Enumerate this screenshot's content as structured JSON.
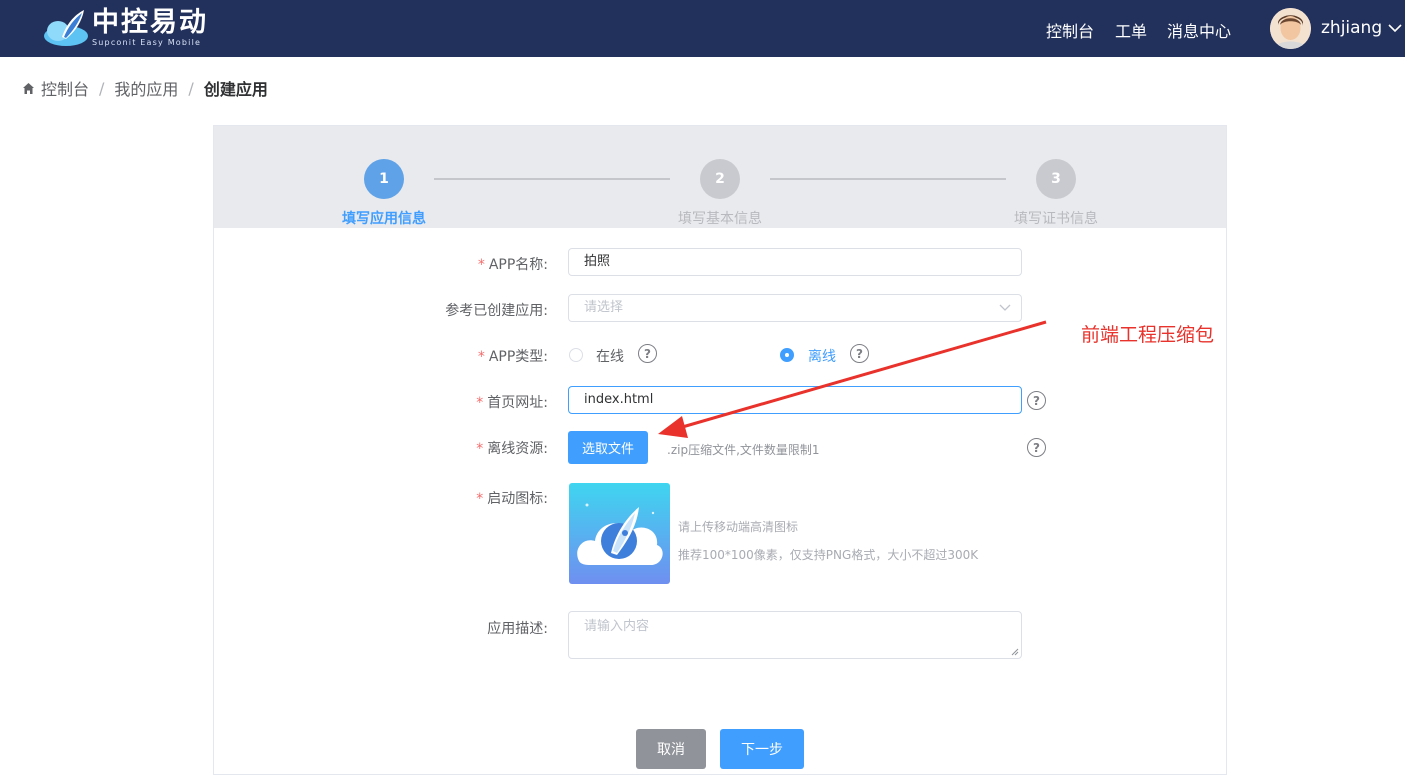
{
  "header": {
    "logo_cn": "中控易动",
    "logo_en": "Supconit Easy Mobile",
    "nav": [
      "控制台",
      "工单",
      "消息中心"
    ],
    "username": "zhjiang"
  },
  "breadcrumb": [
    "控制台",
    "我的应用",
    "创建应用"
  ],
  "steps": [
    {
      "number": "1",
      "label": "填写应用信息",
      "status": "active"
    },
    {
      "number": "2",
      "label": "填写基本信息",
      "status": "pending"
    },
    {
      "number": "3",
      "label": "填写证书信息",
      "status": "pending"
    }
  ],
  "form": {
    "app_name": {
      "label": "APP名称:",
      "value": "拍照"
    },
    "reference_app": {
      "label": "参考已创建应用:",
      "placeholder": "请选择"
    },
    "app_type": {
      "label": "APP类型:",
      "options": [
        "在线",
        "离线"
      ],
      "selected": "离线"
    },
    "homepage": {
      "label": "首页网址:",
      "value": "index.html"
    },
    "offline_resource": {
      "label": "离线资源:",
      "button": "选取文件",
      "hint": ".zip压缩文件,文件数量限制1"
    },
    "launch_icon": {
      "label": "启动图标:",
      "hint1": "请上传移动端高清图标",
      "hint2": "推荐100*100像素，仅支持PNG格式，大小不超过300K"
    },
    "description": {
      "label": "应用描述:",
      "placeholder": "请输入内容"
    }
  },
  "buttons": {
    "cancel": "取消",
    "next": "下一步"
  },
  "annotation": "前端工程压缩包",
  "colors": {
    "header_bg": "#22305c",
    "primary": "#409eff",
    "annotation": "#e8322b"
  }
}
